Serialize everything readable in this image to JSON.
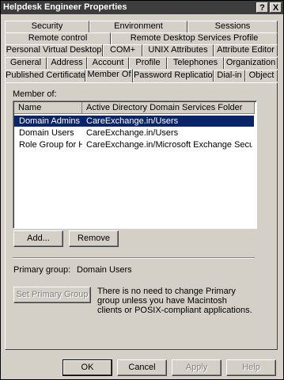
{
  "window": {
    "title": "Helpdesk Engineer Properties",
    "help_label": "?",
    "close_label": "X"
  },
  "tabs": {
    "row1": [
      "Security",
      "Environment",
      "Sessions"
    ],
    "row2": [
      "Remote control",
      "Remote Desktop Services Profile"
    ],
    "row3": [
      "Personal Virtual Desktop",
      "COM+",
      "UNIX Attributes",
      "Attribute Editor"
    ],
    "row4": [
      "General",
      "Address",
      "Account",
      "Profile",
      "Telephones",
      "Organization"
    ],
    "row5": [
      "Published Certificates",
      "Member Of",
      "Password Replication",
      "Dial-in",
      "Object"
    ],
    "active": "Member Of"
  },
  "member_of": {
    "label": "Member of:",
    "columns": [
      "Name",
      "Active Directory Domain Services Folder"
    ],
    "rows": [
      {
        "name": "Domain Admins",
        "folder": "CareExchange.in/Users",
        "selected": true
      },
      {
        "name": "Domain Users",
        "folder": "CareExchange.in/Users",
        "selected": false
      },
      {
        "name": "Role Group for H...",
        "folder": "CareExchange.in/Microsoft Exchange Security G...",
        "selected": false
      }
    ]
  },
  "buttons": {
    "add": "Add...",
    "remove": "Remove",
    "set_primary": "Set Primary Group"
  },
  "primary_group": {
    "label": "Primary group:",
    "value": "Domain Users",
    "note": "There is no need to change Primary group unless you have Macintosh clients or POSIX-compliant applications."
  },
  "footer": {
    "ok": "OK",
    "cancel": "Cancel",
    "apply": "Apply",
    "help": "Help"
  },
  "colors": {
    "titlebar": "#3d3d3d",
    "selection": "#0a246a",
    "face": "#d4d0c8"
  }
}
